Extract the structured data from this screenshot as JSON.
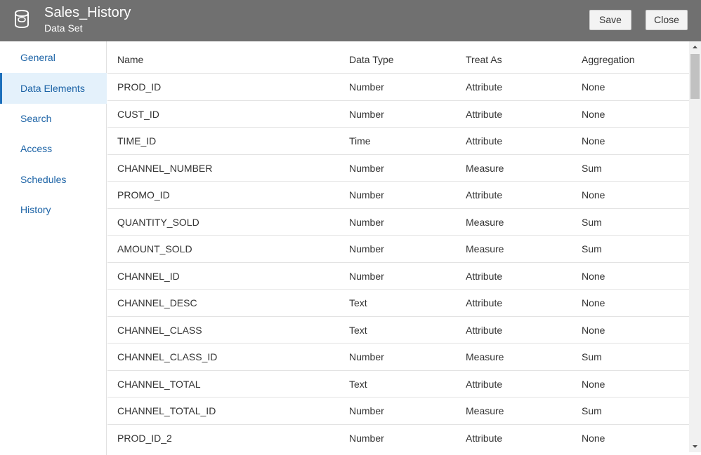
{
  "header": {
    "title": "Sales_History",
    "subtitle": "Data Set",
    "icon": "database-icon",
    "save_label": "Save",
    "close_label": "Close"
  },
  "sidebar": {
    "items": [
      {
        "label": "General",
        "active": false
      },
      {
        "label": "Data Elements",
        "active": true
      },
      {
        "label": "Search",
        "active": false
      },
      {
        "label": "Access",
        "active": false
      },
      {
        "label": "Schedules",
        "active": false
      },
      {
        "label": "History",
        "active": false
      }
    ]
  },
  "table": {
    "columns": [
      "Name",
      "Data Type",
      "Treat As",
      "Aggregation"
    ],
    "rows": [
      [
        "PROD_ID",
        "Number",
        "Attribute",
        "None"
      ],
      [
        "CUST_ID",
        "Number",
        "Attribute",
        "None"
      ],
      [
        "TIME_ID",
        "Time",
        "Attribute",
        "None"
      ],
      [
        "CHANNEL_NUMBER",
        "Number",
        "Measure",
        "Sum"
      ],
      [
        "PROMO_ID",
        "Number",
        "Attribute",
        "None"
      ],
      [
        "QUANTITY_SOLD",
        "Number",
        "Measure",
        "Sum"
      ],
      [
        "AMOUNT_SOLD",
        "Number",
        "Measure",
        "Sum"
      ],
      [
        "CHANNEL_ID",
        "Number",
        "Attribute",
        "None"
      ],
      [
        "CHANNEL_DESC",
        "Text",
        "Attribute",
        "None"
      ],
      [
        "CHANNEL_CLASS",
        "Text",
        "Attribute",
        "None"
      ],
      [
        "CHANNEL_CLASS_ID",
        "Number",
        "Measure",
        "Sum"
      ],
      [
        "CHANNEL_TOTAL",
        "Text",
        "Attribute",
        "None"
      ],
      [
        "CHANNEL_TOTAL_ID",
        "Number",
        "Measure",
        "Sum"
      ],
      [
        "PROD_ID_2",
        "Number",
        "Attribute",
        "None"
      ]
    ]
  },
  "colors": {
    "header_bg": "#707070",
    "nav_link": "#1c63a6",
    "nav_active_bg": "#e4f1fb",
    "nav_active_border": "#1c6fbb"
  }
}
